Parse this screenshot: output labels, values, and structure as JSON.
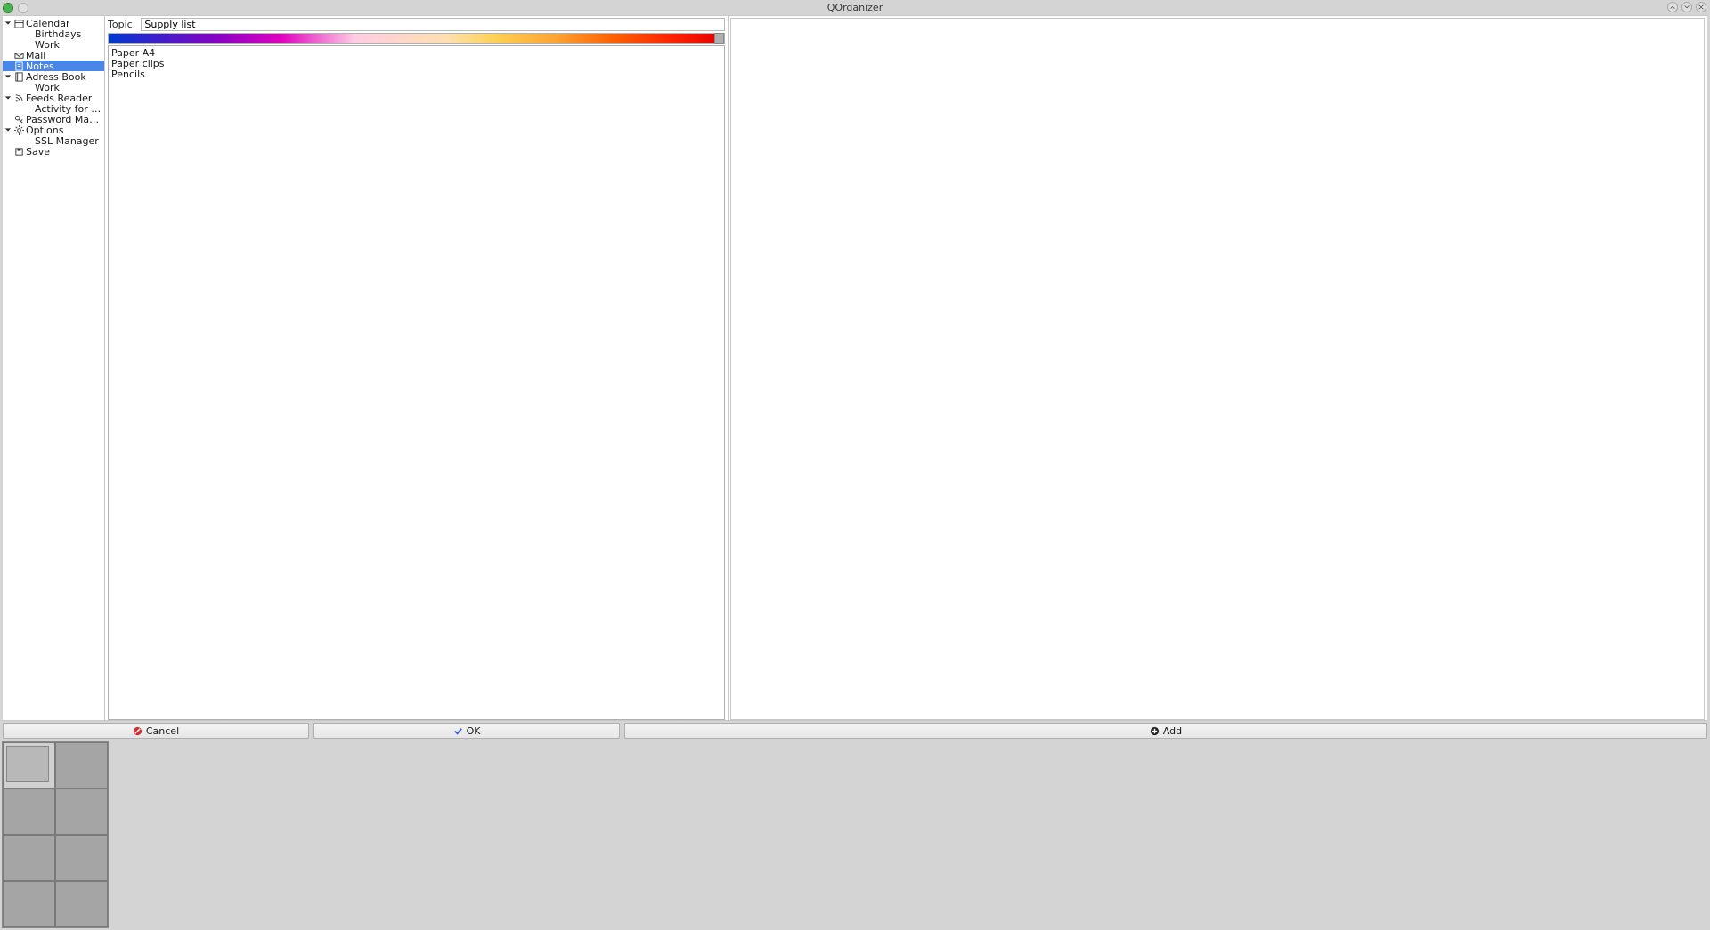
{
  "titlebar": {
    "title": "QOrganizer"
  },
  "sidebar": {
    "items": [
      {
        "label": "Calendar",
        "icon": "calendar-icon",
        "expand": true,
        "top": true
      },
      {
        "label": "Birthdays",
        "child": true
      },
      {
        "label": "Work",
        "child": true
      },
      {
        "label": "Mail",
        "icon": "mail-icon",
        "top": true
      },
      {
        "label": "Notes",
        "icon": "notes-icon",
        "top": true,
        "selected": true
      },
      {
        "label": "Adress Book",
        "icon": "book-icon",
        "expand": true,
        "top": true
      },
      {
        "label": "Work",
        "child": true
      },
      {
        "label": "Feeds Reader",
        "icon": "rss-icon",
        "expand": true,
        "top": true
      },
      {
        "label": "Activity for QO...",
        "child": true
      },
      {
        "label": "Password Man...",
        "icon": "key-icon",
        "top": true
      },
      {
        "label": "Options",
        "icon": "gear-icon",
        "expand": true,
        "top": true
      },
      {
        "label": "SSL Manager",
        "child": true
      },
      {
        "label": "Save",
        "icon": "save-icon",
        "top": true
      }
    ]
  },
  "editor": {
    "topic_label": "Topic:",
    "topic_value": "Supply list",
    "body": "Paper A4\nPaper clips\nPencils"
  },
  "buttons": {
    "cancel": "Cancel",
    "ok": "OK",
    "add": "Add"
  }
}
